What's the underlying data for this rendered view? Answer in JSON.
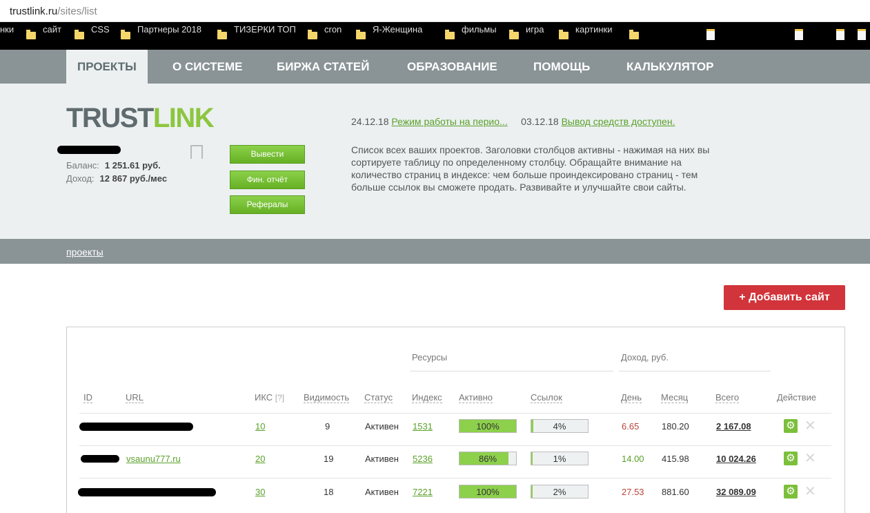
{
  "address": {
    "host": "trustlink.ru",
    "path": "/sites/list"
  },
  "bookmarks": [
    {
      "label": "нки"
    },
    {
      "label": "сайт"
    },
    {
      "label": "CSS"
    },
    {
      "label": "Партнеры 2018"
    },
    {
      "label": "ТИЗЕРКИ ТОП"
    },
    {
      "label": "cron"
    },
    {
      "label": "Я-Женщина"
    },
    {
      "label": "фильмы"
    },
    {
      "label": "игра"
    },
    {
      "label": "картинки"
    }
  ],
  "nav": [
    {
      "label": "Проекты",
      "active": true
    },
    {
      "label": "О системе"
    },
    {
      "label": "Биржа статей"
    },
    {
      "label": "Образование"
    },
    {
      "label": "Помощь"
    },
    {
      "label": "Калькулятор"
    }
  ],
  "logo": {
    "part1": "TRUST",
    "part2": "LINK"
  },
  "account": {
    "balance_label": "Баланс:",
    "balance_value": "1 251.61  руб.",
    "income_label": "Доход:",
    "income_value": "12 867 руб./мес"
  },
  "buttons": {
    "withdraw": "Вывести",
    "report": "Фин. отчёт",
    "referrals": "Рефералы"
  },
  "news": [
    {
      "date": "24.12.18",
      "text": "Режим работы на перио..."
    },
    {
      "date": "03.12.18",
      "text": "Вывод средств доступен."
    }
  ],
  "description": "Список всех ваших проектов. Заголовки столбцов активны - нажимая на них вы сортируете таблицу по определенному столбцу. Обращайте внимание на количество страниц в индексе: чем больше проиндексировано страниц - тем больше ссылок вы сможете продать. Развивайте и улучшайте свои сайты.",
  "breadcrumb": "проекты",
  "add_site_label": "+ Добавить сайт",
  "table": {
    "group_resources": "Ресурсы",
    "group_income": "Доход,  руб.",
    "headers": {
      "id": "ID",
      "url": "URL",
      "iks": "ИКС",
      "iks_hint": "[?]",
      "visibility": "Видимость",
      "status": "Статус",
      "index": "Индекс",
      "active": "Активно",
      "links": "Ссылок",
      "day": "День",
      "month": "Месяц",
      "total": "Всего",
      "action": "Действие"
    },
    "rows": [
      {
        "url": "",
        "iks": "10",
        "visibility": "9",
        "status": "Активен",
        "index": "1531",
        "active_pct": 100,
        "active_label": "100%",
        "links_pct": 4,
        "links_label": "4%",
        "day": "6.65",
        "day_color": "red",
        "month": "180.20",
        "total": "2 167.08"
      },
      {
        "url": "vsaunu777.ru",
        "iks": "20",
        "visibility": "19",
        "status": "Активен",
        "index": "5236",
        "active_pct": 86,
        "active_label": "86%",
        "links_pct": 1,
        "links_label": "1%",
        "day": "14.00",
        "day_color": "green",
        "month": "415.98",
        "total": "10 024.26"
      },
      {
        "url": "",
        "iks": "30",
        "visibility": "18",
        "status": "Активен",
        "index": "7221",
        "active_pct": 100,
        "active_label": "100%",
        "links_pct": 2,
        "links_label": "2%",
        "day": "27.53",
        "day_color": "red",
        "month": "881.60",
        "total": "32 089.09"
      }
    ]
  },
  "icons": {
    "settings": "gear-icon",
    "delete": "close-icon",
    "folder": "folder-icon"
  }
}
